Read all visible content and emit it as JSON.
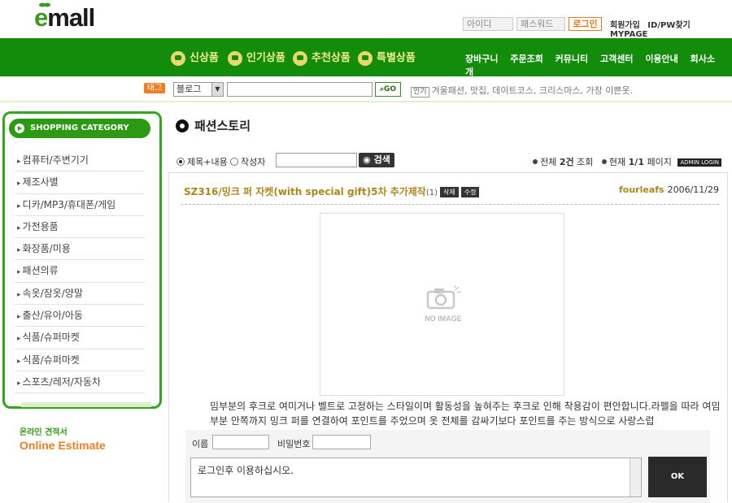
{
  "brand": {
    "logo_e": "e",
    "logo_rest": "mall"
  },
  "login": {
    "id_placeholder": "아이디",
    "pw_placeholder": "패스워드",
    "button": "로그인"
  },
  "top_links": [
    "회원가입",
    "ID/PW찾기",
    "MYPAGE"
  ],
  "main_nav": [
    "신상품",
    "인기상품",
    "추천상품",
    "특별상품"
  ],
  "sub_nav": [
    "장바구니",
    "주문조회",
    "커뮤니티",
    "고객센터",
    "이용안내",
    "회사소개"
  ],
  "search": {
    "tag_label": "태그",
    "select_value": "블로그",
    "go_label": "GO",
    "popular_label": "인기",
    "popular_terms": "겨울패션, 맛집, 데이트코스, 크리스마스, 가장 이쁜옷."
  },
  "sidebar": {
    "header": "SHOPPING CATEGORY",
    "categories": [
      "컴퓨터/주변기기",
      "제조사별",
      "디카/MP3/휴대폰/게임",
      "가전용품",
      "화장품/미용",
      "패션의류",
      "속옷/잠옷/양말",
      "출산/유아/아동",
      "식품/슈퍼마켓",
      "식품/슈퍼마켓",
      "스포츠/레저/자동차"
    ]
  },
  "estimate": {
    "korean": "온라인 견적서",
    "english": "Online Estimate"
  },
  "page": {
    "title": "패션스토리"
  },
  "board": {
    "radio_title_content": "제목+내용",
    "radio_author": "작성자",
    "search_button": "검색",
    "total_label": "전체",
    "total_value": "2건",
    "total_suffix": "조회",
    "current_label": "현재",
    "current_value": "1/1",
    "current_suffix": "페이지",
    "admin_login": "ADMIN LOGIN"
  },
  "post": {
    "title": "SZ316/밍크 퍼 자켓(with special gift)5차 추가제작",
    "comment_count": "(1)",
    "delete_label": "삭제",
    "edit_label": "수정",
    "author": "fourleafs",
    "date": "2006/11/29",
    "no_image": "NO IMAGE",
    "body": "밈부분의 후크로 여미거나 벨트로 고정하는 스타일이며 활동성을 높혀주는 후크로 인해 착용감이 편안합니다.라펠을 따라 여밈부분 안쪽까지 밍크 퍼를 연결하여 포인트를 주었으며 옷 전체를 감싸기보다 포인트를 주는 방식으로 사랑스럽"
  },
  "comment": {
    "name_label": "이름",
    "pw_label": "비밀번호",
    "text": "로그인후 이용하십시오.",
    "ok_label": "OK"
  }
}
